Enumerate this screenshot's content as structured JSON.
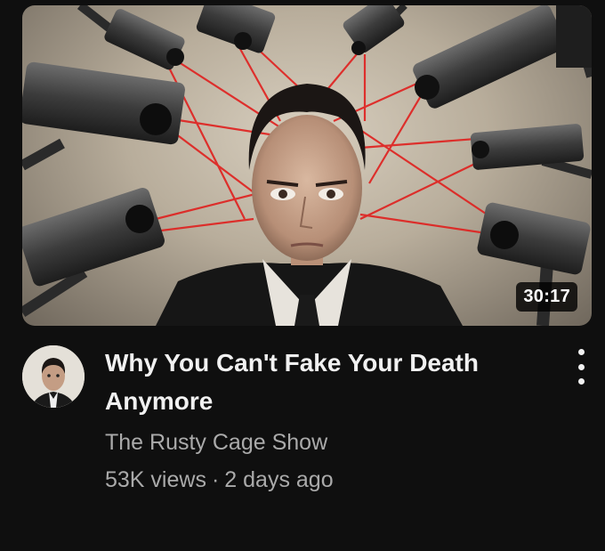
{
  "video": {
    "title": "Why You Can't Fake Your Death Anymore",
    "channel": "The Rusty Cage Show",
    "views": "53K views",
    "separator": "·",
    "age": "2 days ago",
    "duration": "30:17"
  },
  "icons": {
    "menu": "more-vert-icon"
  },
  "colors": {
    "background": "#0f0f0f",
    "title": "#f1f1f1",
    "secondary_text": "#aaaaaa",
    "laser": "#e0201e",
    "duration_bg": "#000000cc"
  }
}
